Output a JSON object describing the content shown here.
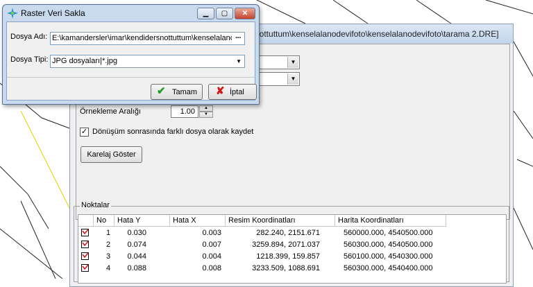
{
  "background": {
    "window_title": "nottuttum\\kenselalanodevifoto\\kenselalanodevifoto\\tarama 2.DRE]",
    "sampling_label": "Örnekleme Aralığı",
    "sampling_value": "1.00",
    "checkbox_label": "Dönüşüm sonrasında farklı dosya olarak kaydet",
    "collage_button": "Karelaj Göster",
    "points_group": "Noktalar",
    "columns": [
      "No",
      "Hata Y",
      "Hata X",
      "Resim Koordinatları",
      "Harita Koordinatları"
    ],
    "rows": [
      {
        "no": "1",
        "hata_y": "0.030",
        "hata_x": "0.003",
        "resim": "282.240, 2151.671",
        "harita": "560000.000, 4540500.000"
      },
      {
        "no": "2",
        "hata_y": "0.074",
        "hata_x": "0.007",
        "resim": "3259.894, 2071.037",
        "harita": "560300.000, 4540500.000"
      },
      {
        "no": "3",
        "hata_y": "0.044",
        "hata_x": "0.004",
        "resim": "1218.399, 159.857",
        "harita": "560100.000, 4540300.000"
      },
      {
        "no": "4",
        "hata_y": "0.088",
        "hata_x": "0.008",
        "resim": "3233.509, 1088.691",
        "harita": "560300.000, 4540400.000"
      }
    ]
  },
  "dialog": {
    "title": "Raster Veri Sakla",
    "file_name_label": "Dosya Adı:",
    "file_name_value": "E:\\kamandersler\\imar\\kendidersnottuttum\\kenselalano",
    "browse_label": "···",
    "file_type_label": "Dosya Tipi:",
    "file_type_value": "JPG dosyaları|*.jpg",
    "ok_label": "Tamam",
    "cancel_label": "İptal"
  },
  "colors": {
    "title_bar": "#c9daee",
    "ok_check": "#1e9a2a",
    "cancel_x": "#d01818"
  }
}
